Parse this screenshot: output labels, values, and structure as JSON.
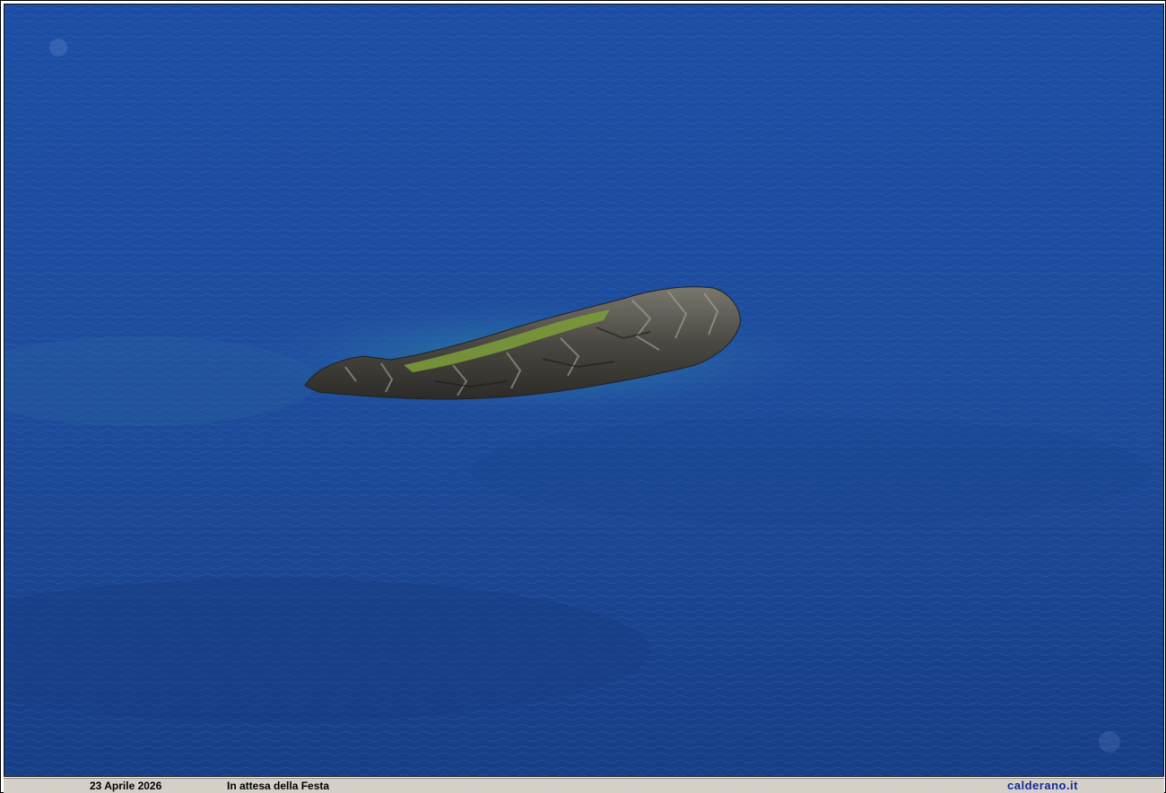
{
  "photo": {
    "subject": "rocky-islet-in-sea",
    "colors": {
      "sea_top": "#1c4fa6",
      "sea_mid": "#1f4e9f",
      "sea_bottom": "#173e86",
      "shallow_water": "#2b7f9a",
      "rock_dark": "#3a3a36",
      "rock_light": "#8c8a82",
      "vegetation": "#7a9a3a"
    }
  },
  "caption": {
    "date": "23 Aprile 2026",
    "title": "In attesa della Festa",
    "site": "calderano.it",
    "site_color": "#102a9a"
  }
}
